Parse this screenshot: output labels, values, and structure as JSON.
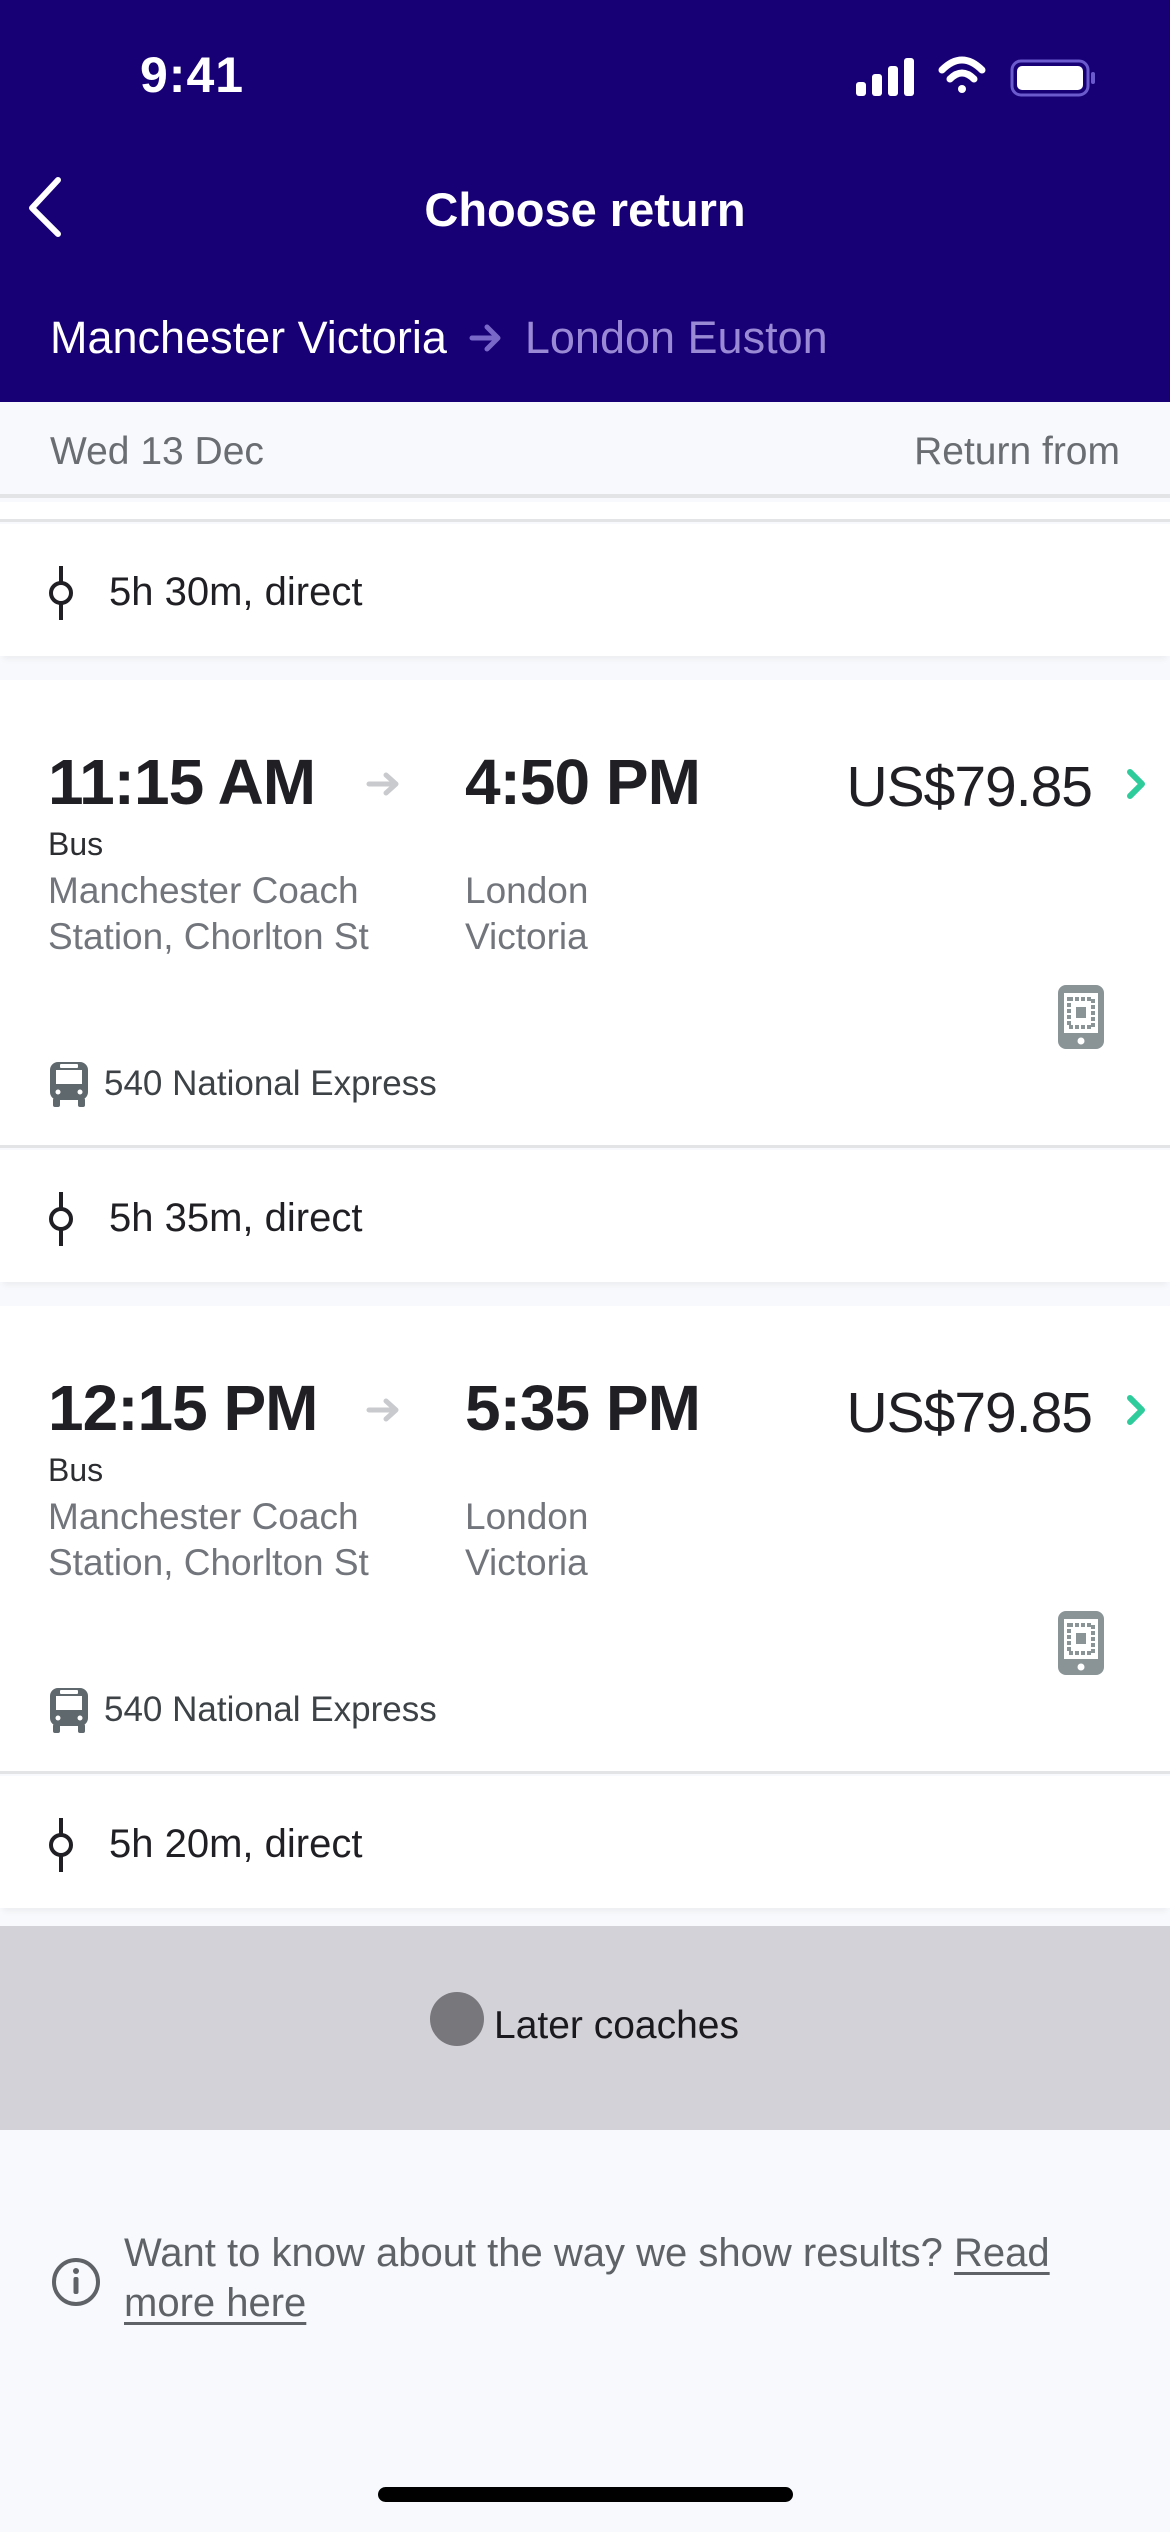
{
  "status_bar": {
    "time": "9:41",
    "icons": [
      "signal-icon",
      "wifi-icon",
      "battery-icon"
    ]
  },
  "header": {
    "title": "Choose return",
    "back_icon": "chevron-left-icon",
    "route": {
      "origin": "Manchester Victoria",
      "destination": "London Euston",
      "arrow_icon": "arrow-right-icon"
    }
  },
  "date_bar": {
    "date": "Wed 13 Dec",
    "label": "Return from"
  },
  "previous_duration": {
    "text": "5h 30m, direct",
    "icon": "stop-icon"
  },
  "journeys": [
    {
      "departure": "11:15 AM",
      "arrival": "4:50 PM",
      "price": "US$79.85",
      "mode": "Bus",
      "from_station": "Manchester Coach Station, Chorlton St",
      "to_station": "London Victoria",
      "operator": "540 National Express",
      "duration": "5h 35m, direct",
      "ticket_icon": "mobile-ticket-icon"
    },
    {
      "departure": "12:15 PM",
      "arrival": "5:35 PM",
      "price": "US$79.85",
      "mode": "Bus",
      "from_station": "Manchester Coach Station, Chorlton St",
      "to_station": "London Victoria",
      "operator": "540 National Express",
      "duration": "5h 20m, direct",
      "ticket_icon": "mobile-ticket-icon"
    }
  ],
  "later_button": {
    "label": "Later coaches"
  },
  "info": {
    "text": "Want to know about the way we show results? ",
    "link": "Read more here",
    "icon": "info-icon"
  },
  "colors": {
    "header_bg": "#170075",
    "accent_chevron": "#2ecc9a",
    "destination_text": "#9a8ad6",
    "later_bg": "#d3d2d8"
  }
}
